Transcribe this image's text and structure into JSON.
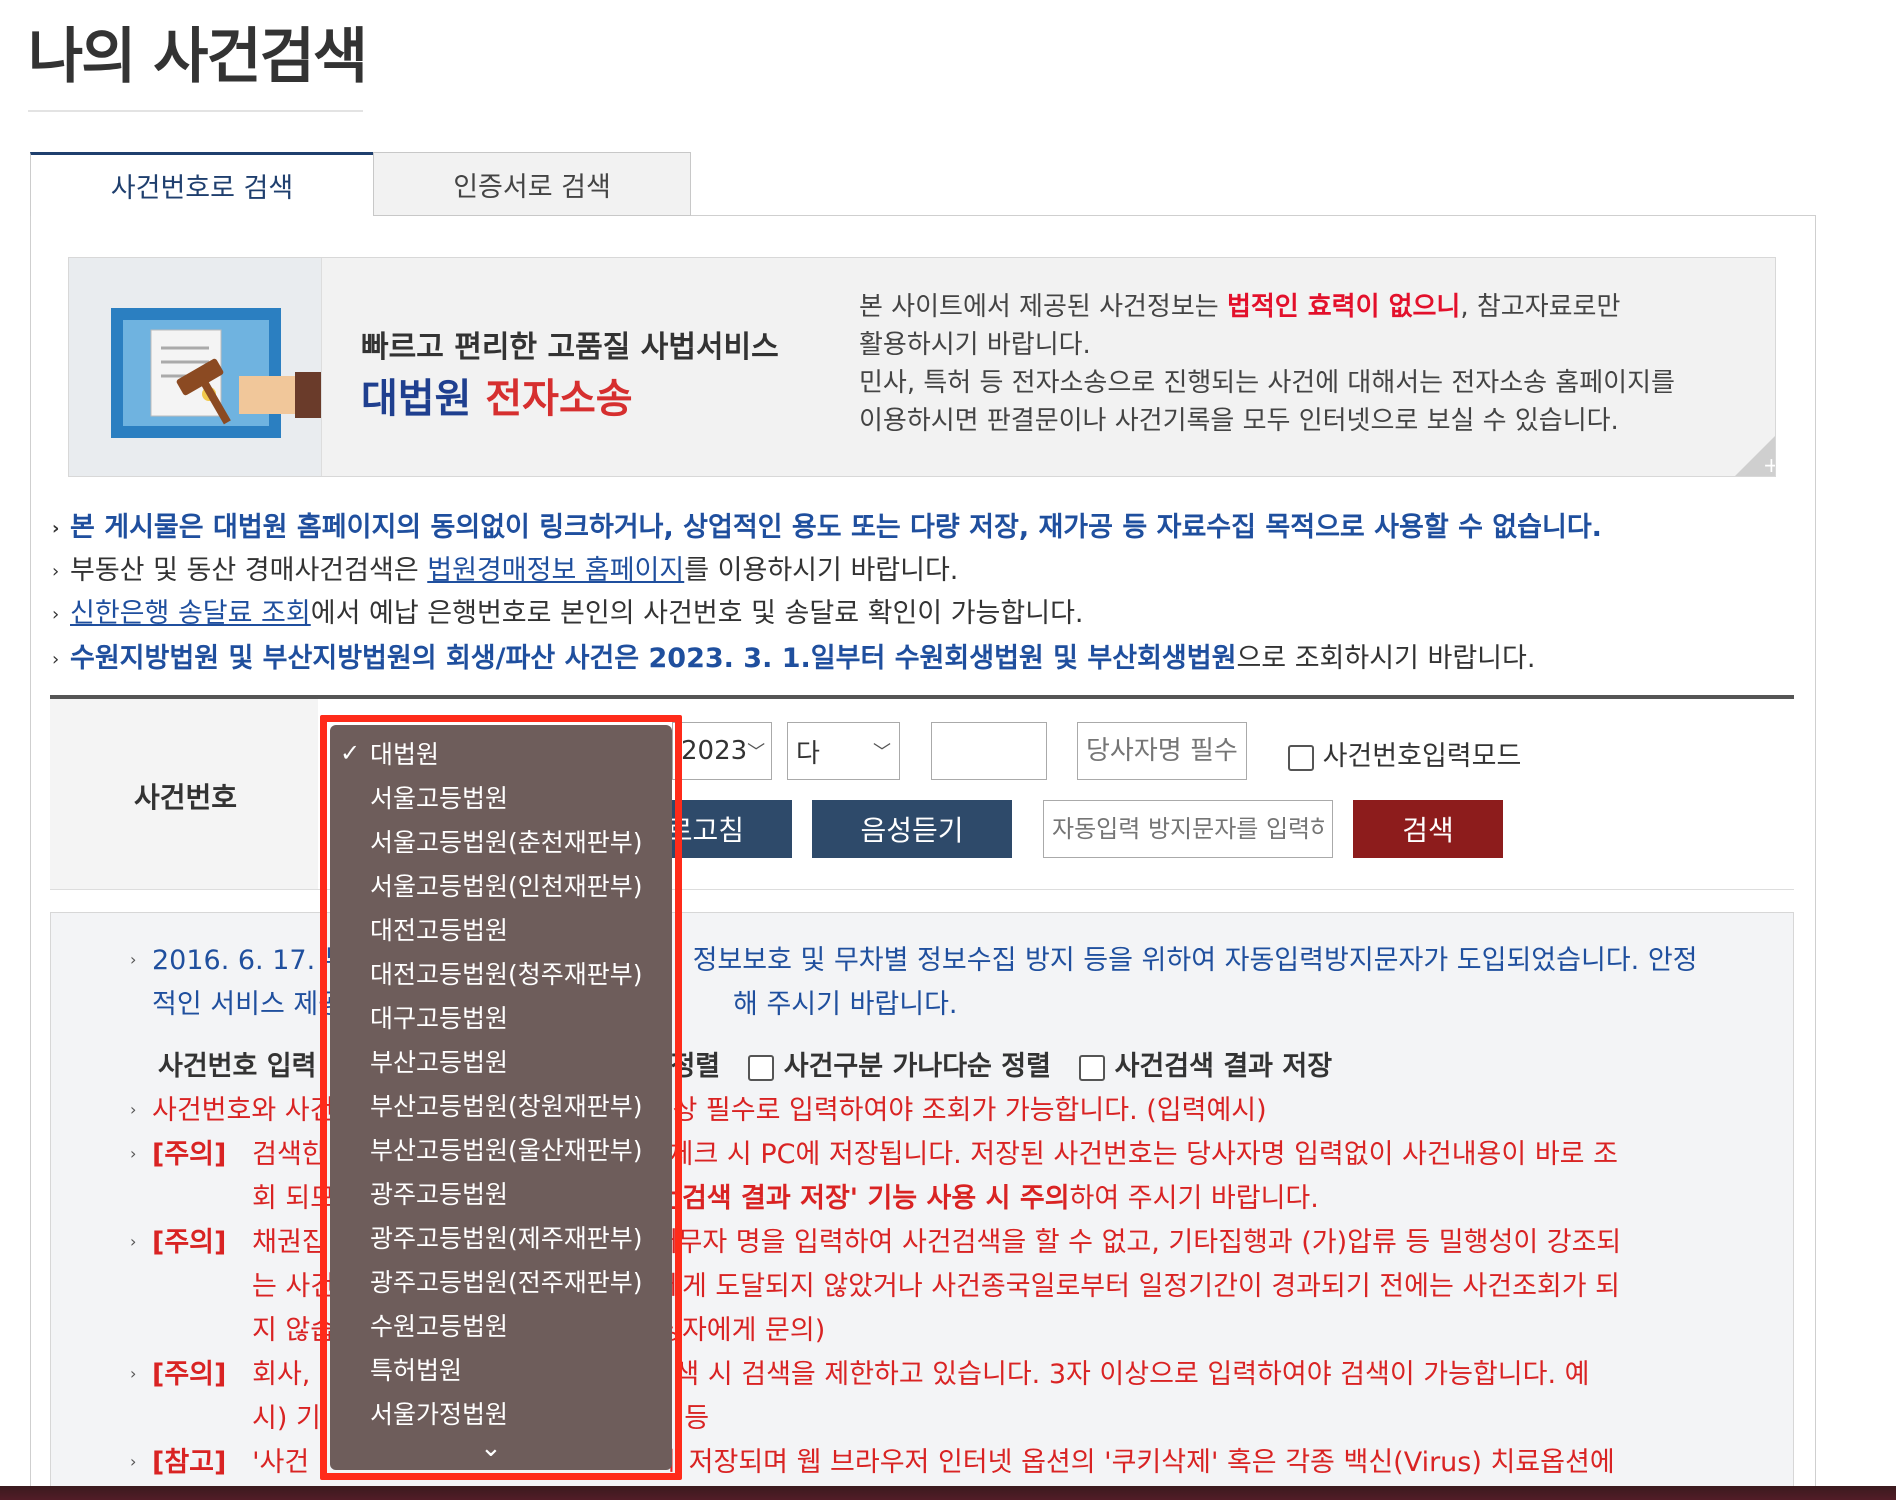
{
  "page": {
    "title": "나의 사건검색"
  },
  "tabs": [
    {
      "label": "사건번호로 검색"
    },
    {
      "label": "인증서로 검색"
    }
  ],
  "banner": {
    "tagline": "빠르고 편리한 고품질 사법서비스",
    "brand_prefix": "대법원",
    "brand_suffix": "전자소송",
    "info_pre": "본 사이트에서 제공된 사건정보는 ",
    "info_warn": "법적인 효력이 없으니",
    "info_post": ", 참고자료로만",
    "info_line2": "활용하시기 바랍니다.",
    "info_line3": "민사, 특허 등 전자소송으로 진행되는 사건에 대해서는 전자소송 홈페이지를",
    "info_line4": "이용하시면 판결문이나 사건기록을 모두 인터넷으로 보실 수 있습니다.",
    "plus": "+"
  },
  "notices": {
    "n1": "본 게시물은 대법원 홈페이지의 동의없이 링크하거나, 상업적인 용도 또는 다량 저장, 재가공 등 자료수집 목적으로 사용할 수 없습니다.",
    "n2_pre": "부동산 및 동산 경매사건검색은 ",
    "n2_link": "법원경매정보 홈페이지",
    "n2_post": "를 이용하시기 바랍니다.",
    "n3_link": "신한은행 송달료 조회",
    "n3_post": "에서 예납 은행번호로 본인의 사건번호 및 송달료 확인이 가능합니다.",
    "n4_bold": "수원지방법원 및 부산지방법원의 회생/파산 사건은 2023. 3. 1.일부터 수원회생법원 및 부산회생법원",
    "n4_post": "으로 조회하시기 바랍니다."
  },
  "form": {
    "label": "사건번호",
    "year": "2023",
    "case_type": "다",
    "case_number": "",
    "party_placeholder": "당사자명 필수입력",
    "mode_label": "사건번호입력모드",
    "refresh_label": "새로고침",
    "refresh_visible": "로고침",
    "audio_label": "음성듣기",
    "captcha_placeholder": "자동입력 방지문자를 입력하세요",
    "search_label": "검색"
  },
  "info": {
    "l1": "2016. 6. 17. 부",
    "l1b": "정보보호 및 무차별 정보수집 방지 등을 위하여 자동입력방지문자가 도입되었습니다. 안정",
    "l2": "적인 서비스 제공",
    "l2b": "해 주시기 바랍니다.",
    "opt_label": "사건번호 입력",
    "opt_sort": "정렬",
    "opt2": "사건구분 가나다순 정렬",
    "opt3": "사건검색 결과 저장",
    "r1": "사건번호와 사건",
    "r1b": "상 필수로 입력하여야 조회가 가능합니다. (입력예시)",
    "tag_notice": "[주의]",
    "tag_ref": "[참고]",
    "c1a": "검색한",
    "c1b": "' 체크 시 PC에 저장됩니다. 저장된 사건번호는 당사자명 입력없이 사건내용이 바로 조",
    "c1c": "회 되므",
    "c1d": "건검색 결과 저장' 기능 사용 시 주의",
    "c1e": "하여 주시기 바랍니다.",
    "c2a": "채권집",
    "c2b": "채무자 명을 입력하여 사건검색을 할 수 없고, 기타집행과 (가)압류 등 밀행성이 강조되",
    "c2c": "는 사건",
    "c2d": "에게 도달되지 않았거나 사건종국일로부터 일정기간이 경과되기 전에는 사건조회가 되",
    "c2e": "지 않습",
    "c2f": "당자에게 문의)",
    "c3a": "회사, ",
    "c3b": " 검색 시 검색을 제한하고 있습니다. 3자 이상으로 입력하여야 검색이 가능합니다. 예",
    "c3c": "시) 기",
    "c3d": "회 등",
    "c4a": "'사건",
    "c4b": "에 저장되며 웹 브라우저 인터넷 옵션의 '쿠키삭제' 혹은 각종 백신(Virus) 치료옵션에"
  },
  "dropdown": {
    "selected": "대법원",
    "options": [
      "대법원",
      "서울고등법원",
      "서울고등법원(춘천재판부)",
      "서울고등법원(인천재판부)",
      "대전고등법원",
      "대전고등법원(청주재판부)",
      "대구고등법원",
      "부산고등법원",
      "부산고등법원(창원재판부)",
      "부산고등법원(울산재판부)",
      "광주고등법원",
      "광주고등법원(제주재판부)",
      "광주고등법원(전주재판부)",
      "수원고등법원",
      "특허법원",
      "서울가정법원"
    ]
  },
  "colors": {
    "accent_navy": "#1f3f6e",
    "search_red": "#8d1c1c",
    "highlight": "#ff2b1a",
    "warn_red": "#d92323"
  }
}
